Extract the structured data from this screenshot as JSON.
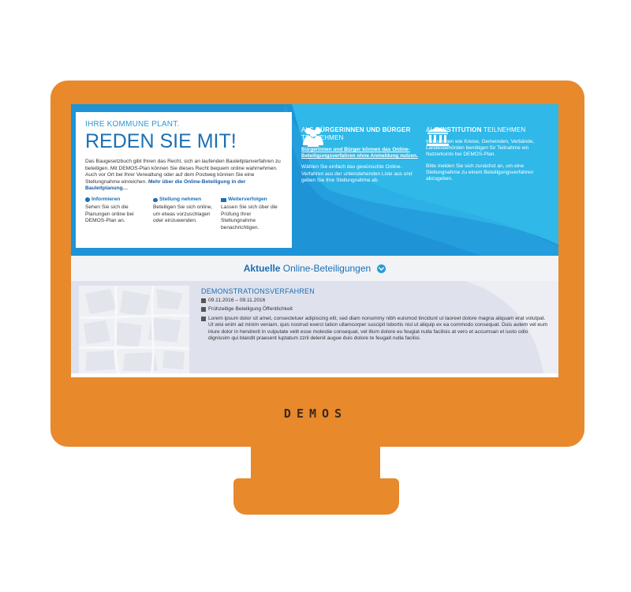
{
  "intro": {
    "kicker": "IHRE KOMMUNE PLANT.",
    "headline": "REDEN SIE MIT!",
    "text": "Das Baugesetzbuch gibt Ihnen das Recht, sich an laufenden Bauleitplanverfahren zu beteiligen. Mit DEMOS-Plan können Sie dieses Recht bequem online wahrnehmen. Auch vor Ort bei Ihrer Verwaltung oder auf dem Postweg können Sie eine Stellungnahme einreichen.",
    "link": "Mehr über die Online-Beteiligung in der Bauleitplanung…",
    "features": [
      {
        "title": "Informieren",
        "text": "Sehen Sie sich die Planungen online bei DEMOS-Plan an."
      },
      {
        "title": "Stellung nehmen",
        "text": "Beteiligen Sie sich online, um etwas vorzuschlagen oder einzuwenden."
      },
      {
        "title": "Weiterverfolgen",
        "text": "Lassen Sie sich über die Prüfung Ihrer Stellungnahme benachrichtigen."
      }
    ]
  },
  "citizens": {
    "title_prefix": "ALS ",
    "title_bold": "BÜRGERINNEN UND BÜRGER",
    "title_suffix": " TEILNEHMEN",
    "link": "Bürgerinnen und Bürger können das Online-Beteiligungsverfahren ohne Anmeldung nutzen.",
    "text": "Wählen Sie einfach das gewünschte Online-Verfahren aus der untenstehenden Liste aus und geben Sie Ihre Stellungnahme ab."
  },
  "institution": {
    "title_prefix": "ALS ",
    "title_bold": "INSTITUTION",
    "title_suffix": " TEILNEHMEN",
    "text1": "Institutionen wie Kreise, Gemeinden, Verbände, Landesbehörden benötigen für Teilnahme ein Nutzerkonto bei DEMOS-Plan.",
    "text2": "Bitte melden Sie sich zunächst an, um eine Stellungnahme zu einem Beteiligungsverfahren abzugeben."
  },
  "section": {
    "bold": "Aktuelle",
    "rest": "Online-Beteiligungen"
  },
  "listing": {
    "title": "DEMONSTRATIONSVERFAHREN",
    "date": "09.11.2016 – 09.11.2016",
    "phase": "Frühzeitige Beteiligung Öffentlichkeit",
    "description": "Lorem ipsum dolor sit amet, consectetuer adipiscing elit, sed diam nonummy nibh euismod tincidunt ut laoreet dolore magna aliquam erat volutpat. Ut wisi enim ad minim veniam, quis nostrud exerci tation ullamcorper suscipit lobortis nisl ut aliquip ex ea commodo consequat. Duis autem vel eum iriure dolor in hendrerit in vulputate velit esse molestie consequat, vel illum dolore eu feugiat nulla facilisis at vero et accumsan et iusto odio dignissim qui blandit praesent luptatum zzril delenit augue duis dolore te feugait nulla facilisi."
  },
  "brand": "DEMOS",
  "colors": {
    "frame": "#e8892c",
    "hero": "#2fb8e8",
    "hero_dark": "#1e94d6",
    "primary": "#1a6fb5"
  }
}
